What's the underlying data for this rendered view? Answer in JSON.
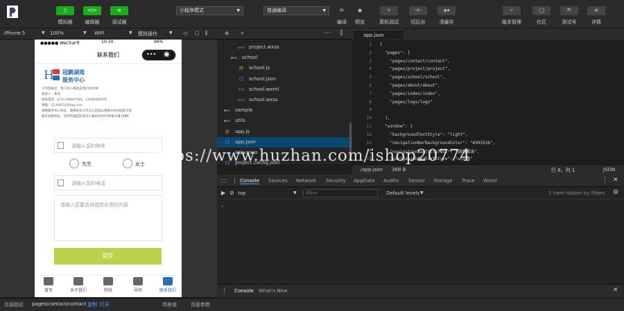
{
  "toolbar": {
    "sim": "模拟器",
    "editor": "编辑器",
    "debug": "调试器",
    "mode": "小程序模式",
    "compile_mode": "普通编译",
    "compile": "编译",
    "preview": "预览",
    "real": "真机调试",
    "background": "切后台",
    "cache": "清缓存",
    "version": "版本管理",
    "community": "社区",
    "test": "测试号",
    "details": "详情"
  },
  "bar2": {
    "device": "iPhone 5",
    "zoom": "100%",
    "network": "WiFi",
    "ops": "模拟操作"
  },
  "phone": {
    "status_left": "●●●●● WeChat令",
    "status_time": "10:34",
    "status_right": "96%",
    "title": "联系我们",
    "logo_text1": "冠鹏湖南",
    "logo_text2": "服务中心",
    "info": [
      "工作室备注：客户的小事就是我们的大事!",
      "联系人：朱笑",
      "联系电话：0731-88687589，13908460495",
      "邮箱：1139051509qq.com",
      "湖南服务中心地址：湖南省长沙市天心区国山南路198号国际大街",
      "服务总部地址：深圳市福田区福华三路88号时代财富大厦18楼F"
    ],
    "name_placeholder": "请输入您的称呼",
    "male": "先生",
    "female": "女士",
    "phone_placeholder": "请输入您的电话",
    "msg_placeholder": "请输入您要咨询或想反馈的内容",
    "submit": "提交",
    "tabs": [
      "首页",
      "关于我们",
      "院校",
      "导师",
      "联系我们"
    ]
  },
  "tree": [
    {
      "name": "project.wxss",
      "icon": "wxss",
      "indent": 2
    },
    {
      "name": "school",
      "icon": "folder",
      "indent": 1
    },
    {
      "name": "school.js",
      "icon": "JS",
      "indent": 2
    },
    {
      "name": "school.json",
      "icon": "{}",
      "indent": 2
    },
    {
      "name": "school.wxml",
      "icon": "<>",
      "indent": 2
    },
    {
      "name": "school.wxss",
      "icon": "wxss",
      "indent": 2
    },
    {
      "name": "sample",
      "icon": "folder",
      "indent": 0
    },
    {
      "name": "utils",
      "icon": "folder",
      "indent": 0
    },
    {
      "name": "app.js",
      "icon": "JS",
      "indent": 0
    },
    {
      "name": "app.json",
      "icon": "{}",
      "indent": 0
    },
    {
      "name": "app.wxss",
      "icon": "wxss",
      "indent": 0
    },
    {
      "name": "project.config.json",
      "icon": "{}",
      "indent": 0
    }
  ],
  "editor": {
    "tab": "app.json",
    "lines": [
      "{",
      "  \"pages\": [",
      "    \"pages/contact/contact\",",
      "    \"pages/project/project\",",
      "    \"pages/school/school\",",
      "    \"pages/about/about\",",
      "    \"pages/index/index\",",
      "    \"pages/logs/logs\"",
      "",
      "  ],",
      "  \"window\": {",
      "    \"backgroundTextStyle\": \"light\",",
      "    \"navigationBarBackgroundColor\": \"#30353b\",",
      "    \"navigationBarTitleText\": \"湖南雅涛\",",
      "    \"navigationBarTextStyle\": \"white\""
    ],
    "status_file": "/app.json",
    "status_size": "368 B",
    "status_pos": "行 8，列 1",
    "status_lang": "JSON"
  },
  "devtools": {
    "tabs": [
      "Console",
      "Sources",
      "Network",
      "Security",
      "AppData",
      "Audits",
      "Sensor",
      "Storage",
      "Trace",
      "Wxml"
    ],
    "context": "top",
    "filter": "Filter",
    "levels": "Default levels",
    "hidden": "1 item hidden by filters",
    "bottom_tabs": [
      "Console",
      "What's New"
    ]
  },
  "footer": {
    "path_label": "页面路径",
    "path": "pages/contact/contact",
    "copy": "复制",
    "open": "打开",
    "scene": "场景值",
    "params": "页面参数"
  },
  "watermark": "https://www.huzhan.com/ishop20774"
}
